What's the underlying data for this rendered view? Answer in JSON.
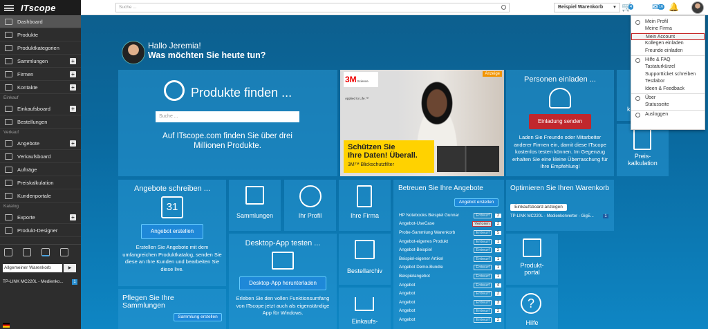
{
  "brand": "ITscope",
  "sidebar": {
    "items": [
      {
        "label": "Dashboard",
        "active": true
      },
      {
        "label": "Produkte"
      },
      {
        "label": "Produktkategorien"
      },
      {
        "label": "Sammlungen",
        "plus": true
      },
      {
        "label": "Firmen",
        "plus": true
      },
      {
        "label": "Kontakte",
        "plus": true
      }
    ],
    "sections": {
      "einkauf": "Einkauf",
      "verkauf": "Verkauf",
      "katalog": "Katalog"
    },
    "einkauf_items": [
      {
        "label": "Einkaufsboard",
        "plus": true
      },
      {
        "label": "Bestellungen"
      }
    ],
    "verkauf_items": [
      {
        "label": "Angebote",
        "plus": true
      },
      {
        "label": "Verkaufsboard"
      },
      {
        "label": "Aufträge"
      },
      {
        "label": "Preiskalkulation"
      },
      {
        "label": "Kundenportale"
      }
    ],
    "katalog_items": [
      {
        "label": "Exporte",
        "plus": true
      },
      {
        "label": "Produkt-Designer"
      }
    ],
    "cart_select": "Allgemeiner Warenkorb",
    "cart_go": "▶",
    "cart_item": "TP-LINK MC220L - Medienko...",
    "cart_item_qty": "1"
  },
  "topbar": {
    "search_placeholder": "Suche ...",
    "cart_name": "Beispiel Warenkorb",
    "cart_badge": "4",
    "notif_badge": "16"
  },
  "greeting": {
    "line1": "Hallo Jeremia!",
    "line2": "Was möchten Sie heute tun?"
  },
  "products": {
    "title": "Produkte finden ...",
    "search_placeholder": "Suche ...",
    "text": "Auf ITscope.com finden Sie über drei Millionen Produkte."
  },
  "ad": {
    "badge": "Anzeige",
    "logo": "3M",
    "logo_sub": "Science. Applied to Life.™",
    "headline1": "Schützen Sie",
    "headline2": "Ihre Daten! Überall.",
    "sub": "3M™ Blickschutzfilter"
  },
  "invite": {
    "title": "Personen einladen ...",
    "button": "Einladung senden",
    "text": "Laden Sie Freunde oder Mitarbeiter anderer Firmen ein, damit diese ITscope kostenlos testen können. Im Gegenzug erhalten Sie eine kleine Überraschung für Ihre Empfehlung!"
  },
  "small_tile_ka": "ka",
  "preis": {
    "label": "Preis-kalkulation"
  },
  "angebote": {
    "title": "Angebote schreiben ...",
    "cal": "31",
    "button": "Angebot erstellen",
    "text": "Erstellen Sie Angebote mit dem umfangreichen Produktkatalog, senden Sie diese an Ihre Kunden und bearbeiten Sie diese live."
  },
  "sammlungen": {
    "label": "Sammlungen"
  },
  "profil": {
    "label": "Ihr Profil"
  },
  "firma": {
    "label": "Ihre Firma"
  },
  "desktop": {
    "title": "Desktop-App testen ...",
    "button": "Desktop-App herunterladen",
    "text": "Erleben Sie den vollen Funktionsumfang von ITscope jetzt auch als eigenständige App für Windows."
  },
  "bestellarchiv": {
    "label": "Bestellarchiv"
  },
  "einkaufs": {
    "label": "Einkaufs-"
  },
  "pflegen": {
    "title": "Pflegen Sie Ihre Sammlungen",
    "button": "Sammlung erstellen"
  },
  "betreuen": {
    "title": "Betreuen Sie Ihre Angebote",
    "button": "Angebot erstellen",
    "rows": [
      {
        "name": "HP Notebooks Beispiel Gunnar",
        "status": "Entwurf",
        "n": "2"
      },
      {
        "name": "Angebot-UseCase",
        "status": "Verloren",
        "n": "2",
        "lost": true
      },
      {
        "name": "Probe-Sammlung Warenkorb",
        "status": "Entwurf",
        "n": "5"
      },
      {
        "name": "Angebot-eigenes Produkt",
        "status": "Entwurf",
        "n": "1"
      },
      {
        "name": "Angebot-Beispiel",
        "status": "Entwurf",
        "n": "2"
      },
      {
        "name": "Beispiel-eigener Artikel",
        "status": "Entwurf",
        "n": "1"
      },
      {
        "name": "Angebot Demo-Bundle",
        "status": "Entwurf",
        "n": "1"
      },
      {
        "name": "Beispielangebot",
        "status": "Entwurf",
        "n": "1"
      },
      {
        "name": "Angebot",
        "status": "Entwurf",
        "n": "4"
      },
      {
        "name": "Angebot",
        "status": "Entwurf",
        "n": "2"
      },
      {
        "name": "Angebot",
        "status": "Entwurf",
        "n": "3"
      },
      {
        "name": "Angebot",
        "status": "Entwurf",
        "n": "2"
      },
      {
        "name": "Angebot",
        "status": "Entwurf",
        "n": "2"
      }
    ]
  },
  "optimieren": {
    "title": "Optimieren Sie Ihren Warenkorb",
    "button": "Einkaufsboard anzeigen",
    "item": "TP-LINK MC220L - Medienkonverter - GigE...",
    "n": "1"
  },
  "portal": {
    "label": "Produkt-portal"
  },
  "hilfe": {
    "label": "Hilfe"
  },
  "dropdown": {
    "items": [
      {
        "label": "Mein Profil",
        "icon": true
      },
      {
        "label": "Meine Firma"
      },
      {
        "label": "Mein Account",
        "selected": true
      },
      {
        "label": "Kollegen einladen"
      },
      {
        "label": "Freunde einladen"
      },
      {
        "label": "Hilfe & FAQ",
        "icon": true,
        "sep": true
      },
      {
        "label": "Tastaturkürzel"
      },
      {
        "label": "Supportticket schreiben"
      },
      {
        "label": "Testlabor"
      },
      {
        "label": "Ideen & Feedback"
      },
      {
        "label": "Über",
        "icon": true,
        "sep": true
      },
      {
        "label": "Statusseite"
      },
      {
        "label": "Ausloggen",
        "icon": true,
        "sep": true
      }
    ]
  }
}
